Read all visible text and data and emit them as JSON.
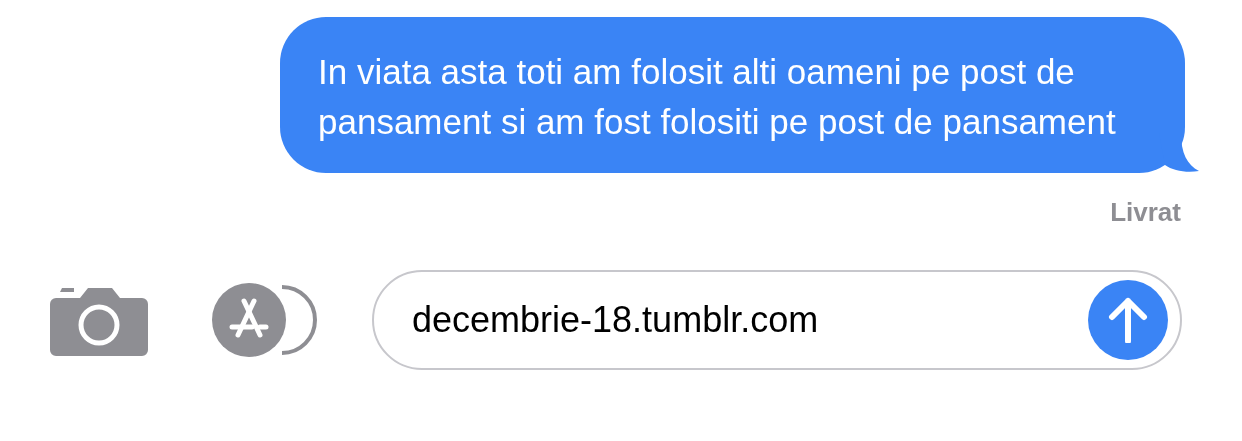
{
  "message": {
    "text": "In viata asta toti am folosit alti oameni pe post de pansament si am fost folositi pe post de pansament",
    "status": "Livrat"
  },
  "composer": {
    "value": "decembrie-18.tumblr.com"
  }
}
